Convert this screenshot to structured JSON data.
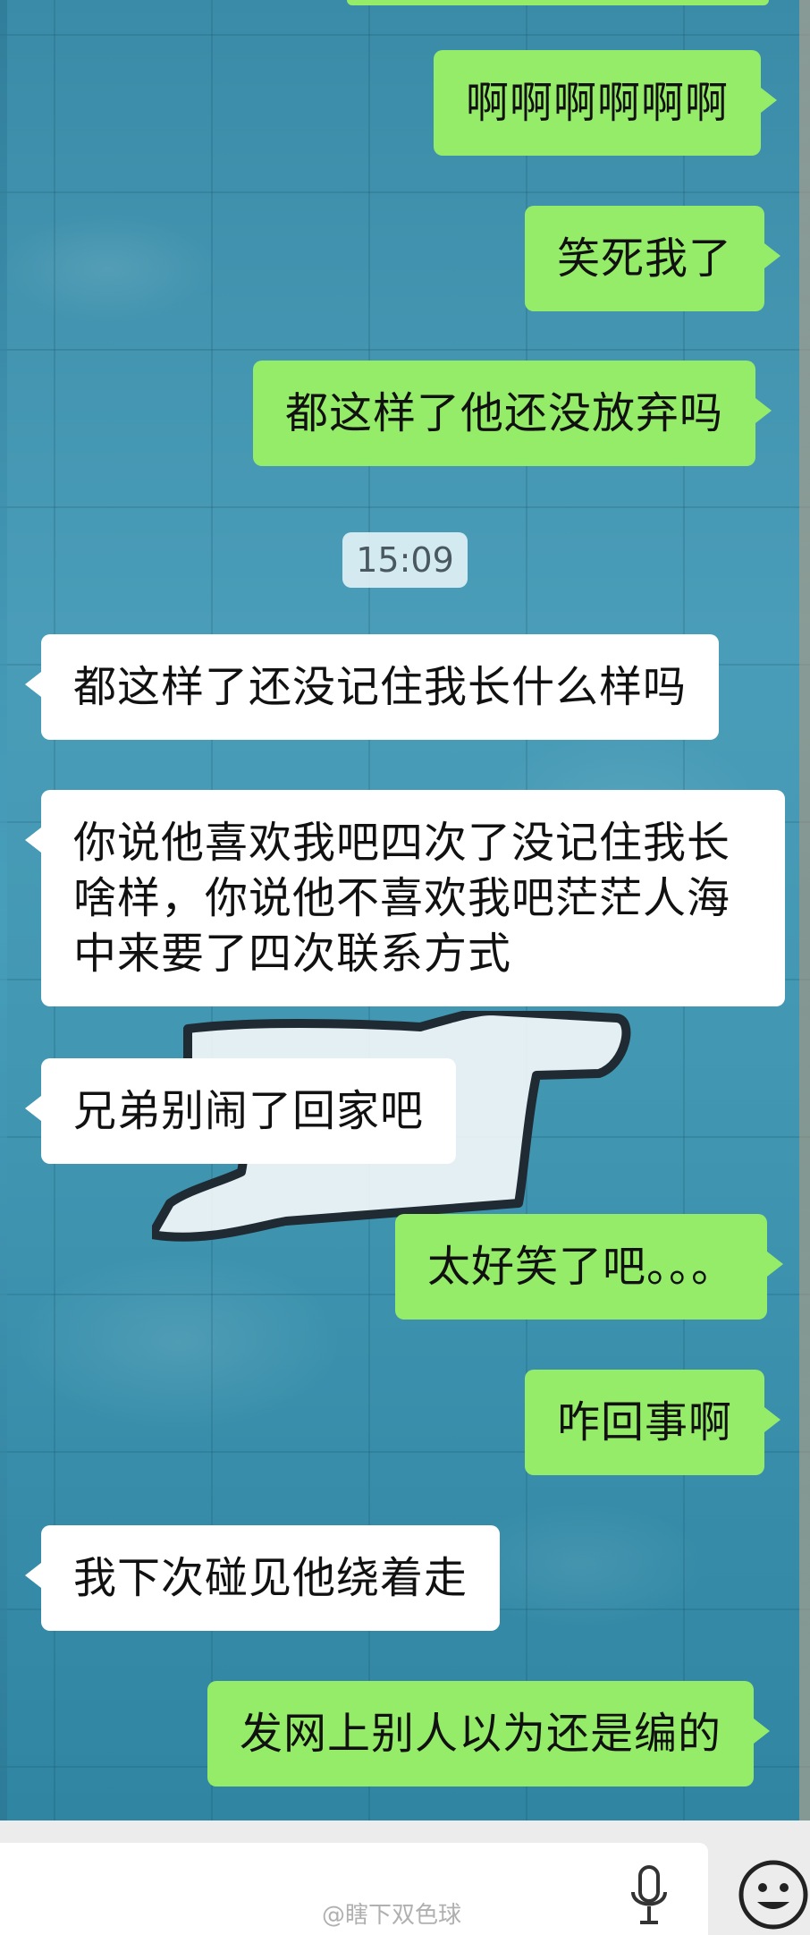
{
  "chat": {
    "timestamp": "15:09",
    "messages": [
      {
        "side": "sent",
        "text": "啊啊啊啊啊啊"
      },
      {
        "side": "sent",
        "text": "笑死我了"
      },
      {
        "side": "sent",
        "text": "都这样了他还没放弃吗"
      },
      {
        "side": "recv",
        "text": "都这样了还没记住我长什么样吗"
      },
      {
        "side": "recv",
        "text": "你说他喜欢我吧四次了没记住我长啥样，你说他不喜欢我吧茫茫人海中来要了四次联系方式"
      },
      {
        "side": "recv",
        "text": "兄弟别闹了回家吧"
      },
      {
        "side": "sent",
        "text": "太好笑了吧。。。"
      },
      {
        "side": "sent",
        "text": "咋回事啊"
      },
      {
        "side": "recv",
        "text": "我下次碰见他绕着走"
      },
      {
        "side": "sent",
        "text": "发网上别人以为还是编的"
      }
    ]
  },
  "input": {
    "mic_icon": "microphone-icon",
    "emoji_icon": "smiley-face-icon"
  },
  "watermark": "@瞎下双色球",
  "colors": {
    "sent_bubble": "#95ec69",
    "recv_bubble": "#ffffff",
    "wallpaper": "#3f93ad"
  }
}
